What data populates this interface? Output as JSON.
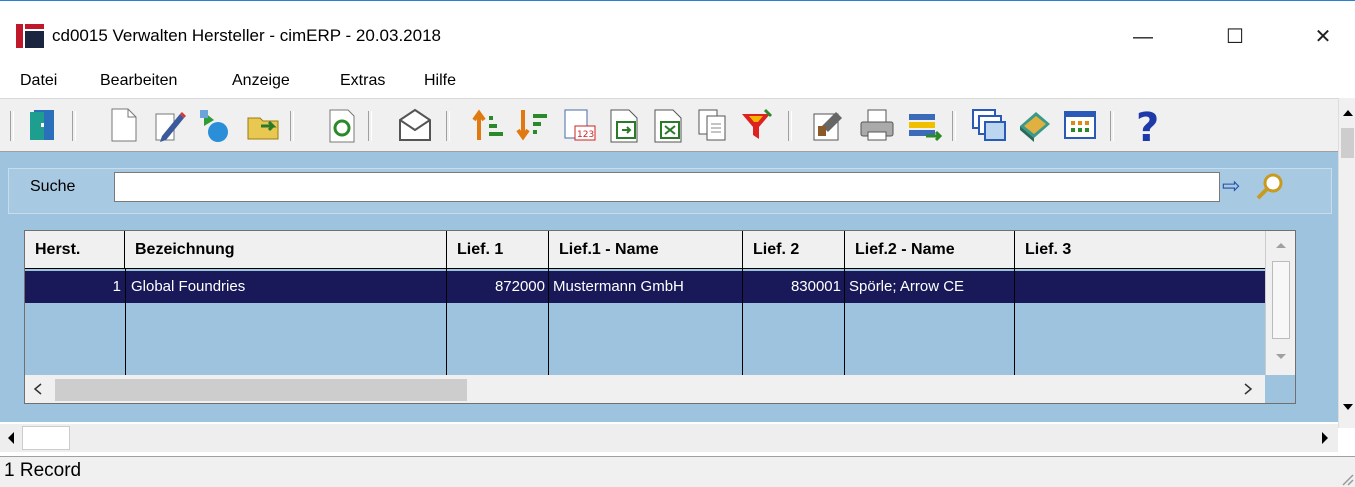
{
  "window": {
    "title": "cd0015 Verwalten Hersteller - cimERP - 20.03.2018",
    "minimize": "—",
    "maximize": "☐",
    "close": "✕"
  },
  "menu": [
    "Datei",
    "Bearbeiten",
    "Anzeige",
    "Extras",
    "Hilfe"
  ],
  "toolbar": {
    "icons": [
      "exit-icon",
      "new-document-icon",
      "edit-icon",
      "copy-record-icon",
      "open-folder-icon",
      "refresh-icon",
      "email-icon",
      "sort-ascending-icon",
      "sort-descending-icon",
      "number-format-icon",
      "export-icon",
      "excel-export-icon",
      "copy-icon",
      "filter-icon",
      "properties-icon",
      "print-icon",
      "transfer-icon",
      "windows-icon",
      "book-icon",
      "table-layout-icon",
      "help-icon"
    ]
  },
  "search": {
    "label": "Suche",
    "value": ""
  },
  "grid": {
    "columns": [
      "Herst.",
      "Bezeichnung",
      "Lief. 1",
      "Lief.1 - Name",
      "Lief. 2",
      "Lief.2 - Name",
      "Lief. 3"
    ],
    "rows": [
      {
        "herst": "1",
        "bezeichnung": "Global Foundries",
        "lief1": "872000",
        "lief1_name": "Mustermann GmbH",
        "lief2": "830001",
        "lief2_name": "Spörle; Arrow CE",
        "lief3": ""
      }
    ]
  },
  "status": {
    "text": "1 Record"
  },
  "colors": {
    "panel": "#9dc3de",
    "selected_row": "#19195a"
  }
}
